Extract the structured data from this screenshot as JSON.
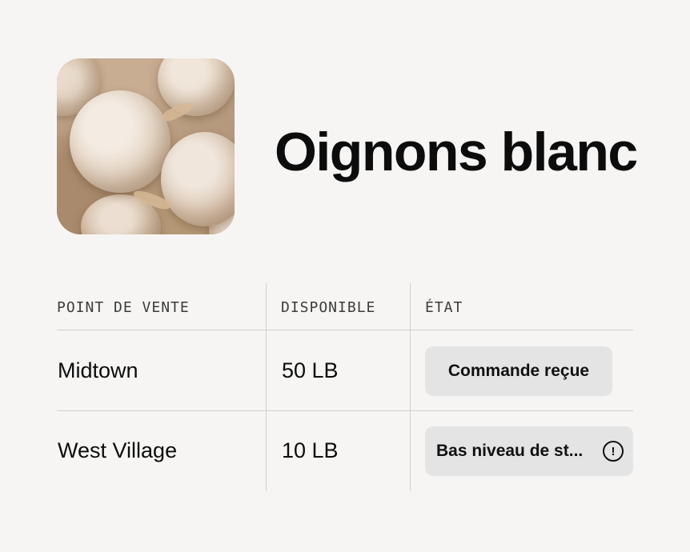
{
  "product": {
    "title": "Oignons blanc",
    "image_icon": "onion-photo"
  },
  "table": {
    "headers": [
      "POINT DE VENTE",
      "DISPONIBLE",
      "ÉTAT"
    ],
    "rows": [
      {
        "location": "Midtown",
        "available": "50 LB",
        "status": "Commande reçue",
        "status_icon": null
      },
      {
        "location": "West Village",
        "available": "10 LB",
        "status": "Bas niveau de st...",
        "status_icon": "alert-circle-icon"
      }
    ]
  },
  "colors": {
    "background": "#f6f5f4",
    "badge": "#e4e4e4",
    "divider": "#cfcfcf",
    "text": "#0c0c0c"
  }
}
